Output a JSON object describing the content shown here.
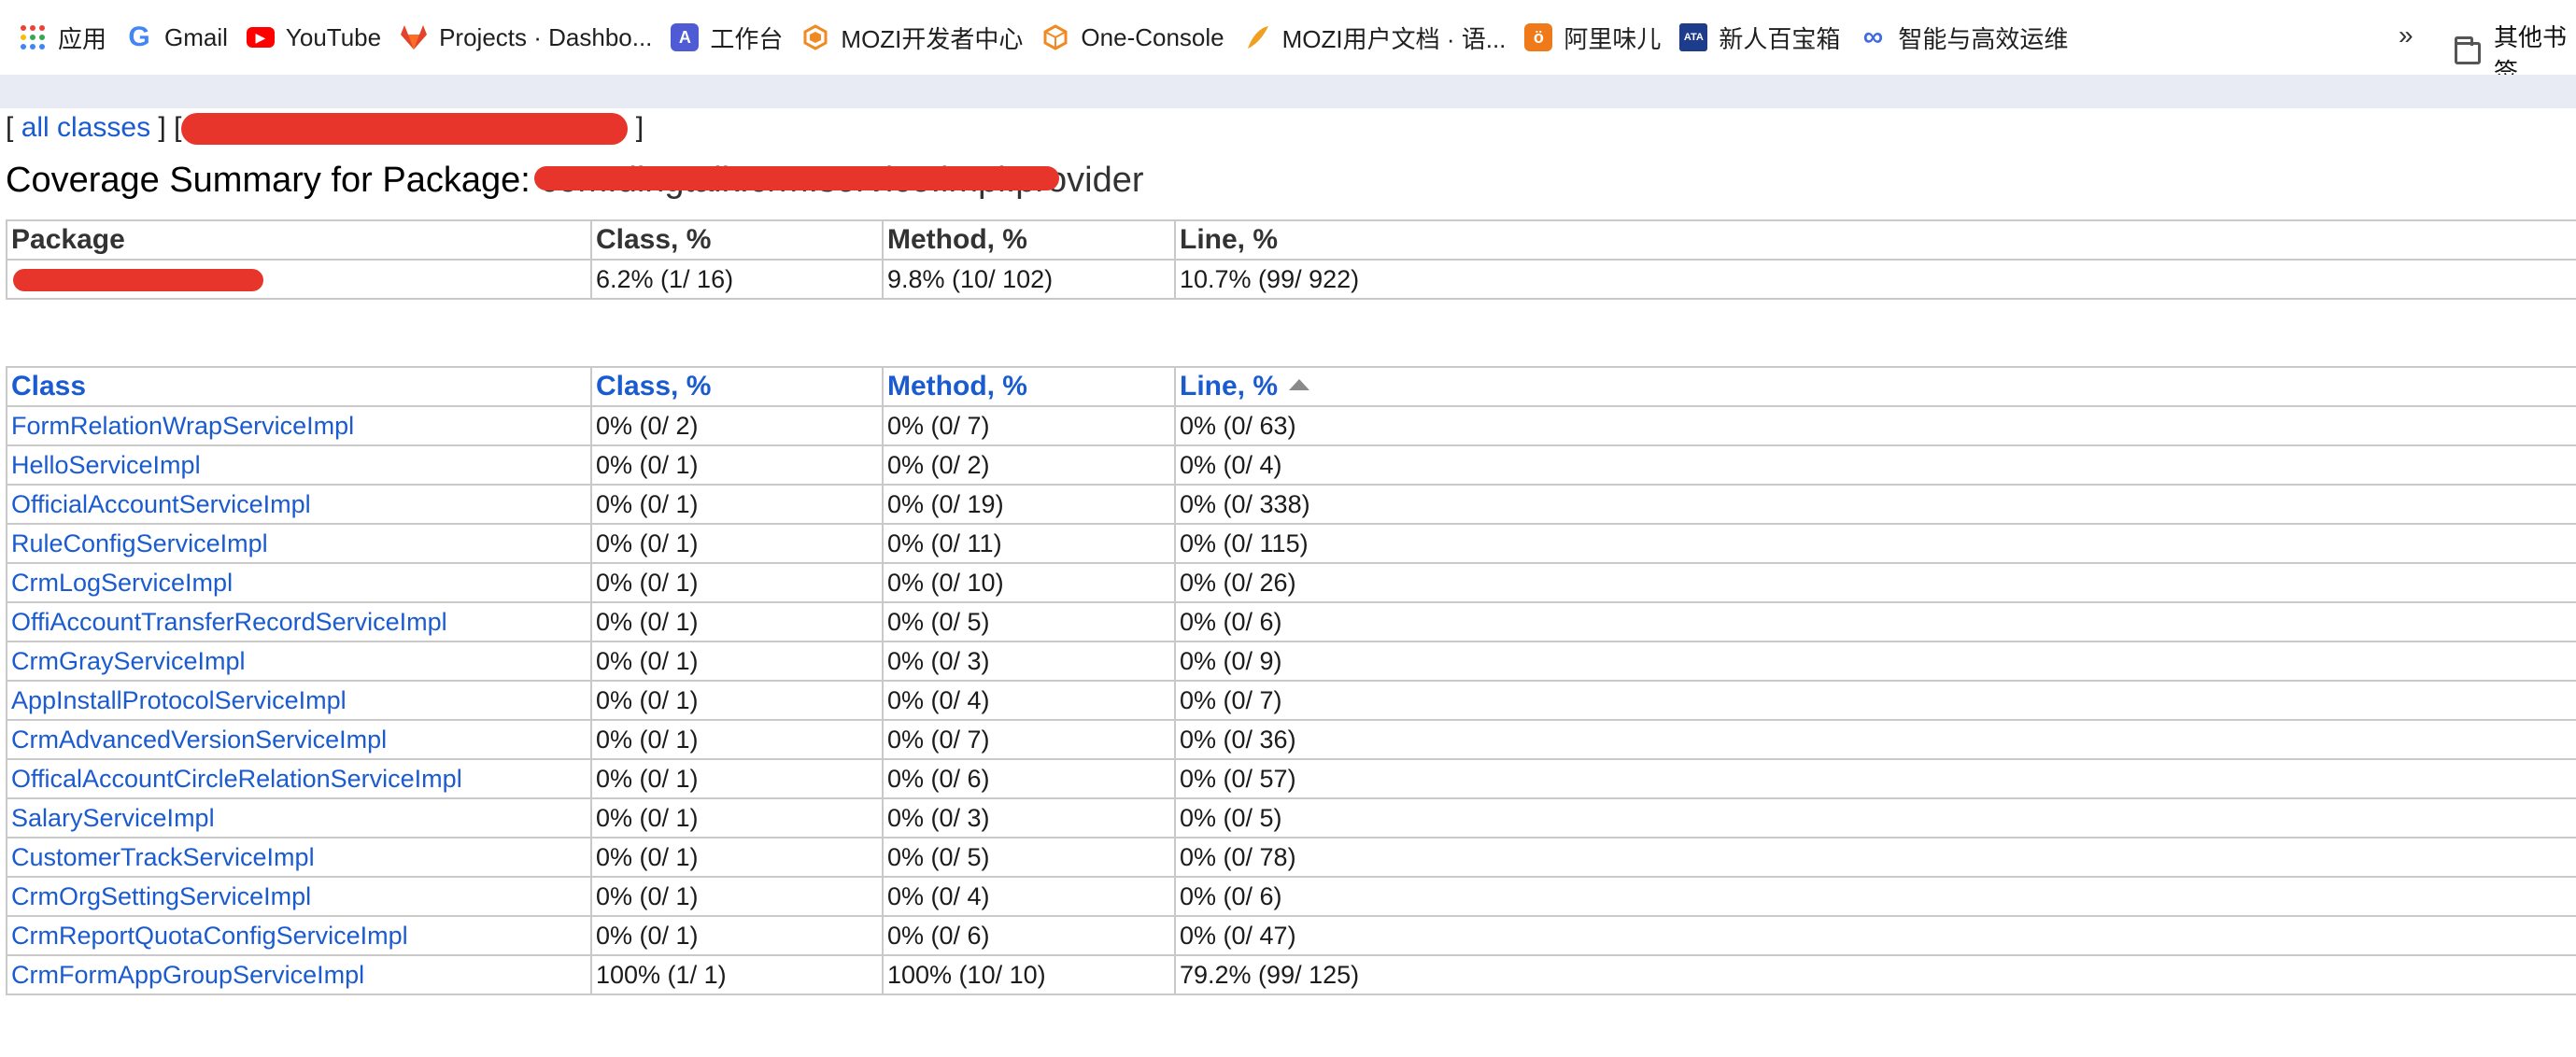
{
  "bookmarks": [
    {
      "label": "应用",
      "icon": "apps-grid-icon"
    },
    {
      "label": "Gmail",
      "icon": "google-g-icon",
      "color": "#4285f4"
    },
    {
      "label": "YouTube",
      "icon": "youtube-play-icon",
      "color": "#ff0000"
    },
    {
      "label": "Projects · Dashbo...",
      "icon": "gitlab-icon",
      "color": "#e2432a"
    },
    {
      "label": "工作台",
      "icon": "a-letter-icon",
      "color": "#4f5bd5"
    },
    {
      "label": "MOZI开发者中心",
      "icon": "mozi-cube-icon",
      "color": "#f08a24"
    },
    {
      "label": "One-Console",
      "icon": "cube-outline-icon",
      "color": "#f08a24"
    },
    {
      "label": "MOZI用户文档 · 语...",
      "icon": "feather-icon",
      "color": "#f0a020"
    },
    {
      "label": "阿里味儿",
      "icon": "orange-badge-icon",
      "color": "#f07a1a"
    },
    {
      "label": "新人百宝箱",
      "icon": "ata-icon",
      "color": "#1e3c8c"
    },
    {
      "label": "智能与高效运维",
      "icon": "infinity-icon",
      "color": "#3f6be0"
    }
  ],
  "bookmarks_more": "»",
  "other_bookmarks": "其他书签",
  "crumbs": {
    "all_classes": "all classes",
    "open": "[",
    "close": "]",
    "mid": "] ["
  },
  "title": {
    "prefix": "Coverage Summary for Package: ",
    "package_name": "com.dingtalk.crm.service.impl.provider"
  },
  "package_table": {
    "headers": [
      "Package",
      "Class, %",
      "Method, %",
      "Line, %"
    ],
    "row": {
      "class": "6.2% (1/ 16)",
      "method": "9.8% (10/ 102)",
      "line": "10.7% (99/ 922)"
    }
  },
  "class_table": {
    "headers": [
      "Class",
      "Class, %",
      "Method, %",
      "Line, %"
    ],
    "rows": [
      {
        "name": "FormRelationWrapServiceImpl",
        "class": "0% (0/ 2)",
        "method": "0% (0/ 7)",
        "line": "0% (0/ 63)"
      },
      {
        "name": "HelloServiceImpl",
        "class": "0% (0/ 1)",
        "method": "0% (0/ 2)",
        "line": "0% (0/ 4)"
      },
      {
        "name": "OfficialAccountServiceImpl",
        "class": "0% (0/ 1)",
        "method": "0% (0/ 19)",
        "line": "0% (0/ 338)"
      },
      {
        "name": "RuleConfigServiceImpl",
        "class": "0% (0/ 1)",
        "method": "0% (0/ 11)",
        "line": "0% (0/ 115)"
      },
      {
        "name": "CrmLogServiceImpl",
        "class": "0% (0/ 1)",
        "method": "0% (0/ 10)",
        "line": "0% (0/ 26)"
      },
      {
        "name": "OffiAccountTransferRecordServiceImpl",
        "class": "0% (0/ 1)",
        "method": "0% (0/ 5)",
        "line": "0% (0/ 6)"
      },
      {
        "name": "CrmGrayServiceImpl",
        "class": "0% (0/ 1)",
        "method": "0% (0/ 3)",
        "line": "0% (0/ 9)"
      },
      {
        "name": "AppInstallProtocolServiceImpl",
        "class": "0% (0/ 1)",
        "method": "0% (0/ 4)",
        "line": "0% (0/ 7)"
      },
      {
        "name": "CrmAdvancedVersionServiceImpl",
        "class": "0% (0/ 1)",
        "method": "0% (0/ 7)",
        "line": "0% (0/ 36)"
      },
      {
        "name": "OfficalAccountCircleRelationServiceImpl",
        "class": "0% (0/ 1)",
        "method": "0% (0/ 6)",
        "line": "0% (0/ 57)"
      },
      {
        "name": "SalaryServiceImpl",
        "class": "0% (0/ 1)",
        "method": "0% (0/ 3)",
        "line": "0% (0/ 5)"
      },
      {
        "name": "CustomerTrackServiceImpl",
        "class": "0% (0/ 1)",
        "method": "0% (0/ 5)",
        "line": "0% (0/ 78)"
      },
      {
        "name": "CrmOrgSettingServiceImpl",
        "class": "0% (0/ 1)",
        "method": "0% (0/ 4)",
        "line": "0% (0/ 6)"
      },
      {
        "name": "CrmReportQuotaConfigServiceImpl",
        "class": "0% (0/ 1)",
        "method": "0% (0/ 6)",
        "line": "0% (0/ 47)"
      },
      {
        "name": "CrmFormAppGroupServiceImpl",
        "class": "100% (1/ 1)",
        "method": "100% (10/ 10)",
        "line": "79.2% (99/ 125)"
      }
    ]
  },
  "colors": {
    "link": "#1a5bd0",
    "redaction": "#e7352c",
    "strip": "#e8ebf3",
    "border": "#c9c9c9"
  }
}
